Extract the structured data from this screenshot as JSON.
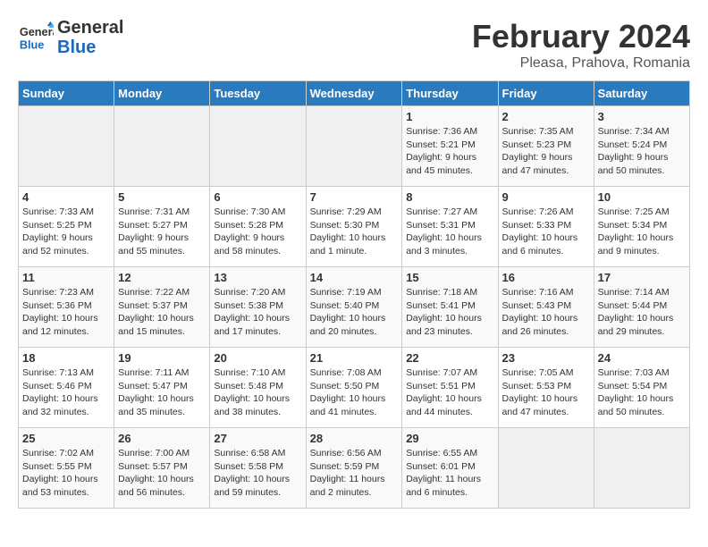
{
  "header": {
    "logo_line1": "General",
    "logo_line2": "Blue",
    "month": "February 2024",
    "location": "Pleasa, Prahova, Romania"
  },
  "weekdays": [
    "Sunday",
    "Monday",
    "Tuesday",
    "Wednesday",
    "Thursday",
    "Friday",
    "Saturday"
  ],
  "weeks": [
    [
      {
        "day": "",
        "info": ""
      },
      {
        "day": "",
        "info": ""
      },
      {
        "day": "",
        "info": ""
      },
      {
        "day": "",
        "info": ""
      },
      {
        "day": "1",
        "info": "Sunrise: 7:36 AM\nSunset: 5:21 PM\nDaylight: 9 hours\nand 45 minutes."
      },
      {
        "day": "2",
        "info": "Sunrise: 7:35 AM\nSunset: 5:23 PM\nDaylight: 9 hours\nand 47 minutes."
      },
      {
        "day": "3",
        "info": "Sunrise: 7:34 AM\nSunset: 5:24 PM\nDaylight: 9 hours\nand 50 minutes."
      }
    ],
    [
      {
        "day": "4",
        "info": "Sunrise: 7:33 AM\nSunset: 5:25 PM\nDaylight: 9 hours\nand 52 minutes."
      },
      {
        "day": "5",
        "info": "Sunrise: 7:31 AM\nSunset: 5:27 PM\nDaylight: 9 hours\nand 55 minutes."
      },
      {
        "day": "6",
        "info": "Sunrise: 7:30 AM\nSunset: 5:28 PM\nDaylight: 9 hours\nand 58 minutes."
      },
      {
        "day": "7",
        "info": "Sunrise: 7:29 AM\nSunset: 5:30 PM\nDaylight: 10 hours\nand 1 minute."
      },
      {
        "day": "8",
        "info": "Sunrise: 7:27 AM\nSunset: 5:31 PM\nDaylight: 10 hours\nand 3 minutes."
      },
      {
        "day": "9",
        "info": "Sunrise: 7:26 AM\nSunset: 5:33 PM\nDaylight: 10 hours\nand 6 minutes."
      },
      {
        "day": "10",
        "info": "Sunrise: 7:25 AM\nSunset: 5:34 PM\nDaylight: 10 hours\nand 9 minutes."
      }
    ],
    [
      {
        "day": "11",
        "info": "Sunrise: 7:23 AM\nSunset: 5:36 PM\nDaylight: 10 hours\nand 12 minutes."
      },
      {
        "day": "12",
        "info": "Sunrise: 7:22 AM\nSunset: 5:37 PM\nDaylight: 10 hours\nand 15 minutes."
      },
      {
        "day": "13",
        "info": "Sunrise: 7:20 AM\nSunset: 5:38 PM\nDaylight: 10 hours\nand 17 minutes."
      },
      {
        "day": "14",
        "info": "Sunrise: 7:19 AM\nSunset: 5:40 PM\nDaylight: 10 hours\nand 20 minutes."
      },
      {
        "day": "15",
        "info": "Sunrise: 7:18 AM\nSunset: 5:41 PM\nDaylight: 10 hours\nand 23 minutes."
      },
      {
        "day": "16",
        "info": "Sunrise: 7:16 AM\nSunset: 5:43 PM\nDaylight: 10 hours\nand 26 minutes."
      },
      {
        "day": "17",
        "info": "Sunrise: 7:14 AM\nSunset: 5:44 PM\nDaylight: 10 hours\nand 29 minutes."
      }
    ],
    [
      {
        "day": "18",
        "info": "Sunrise: 7:13 AM\nSunset: 5:46 PM\nDaylight: 10 hours\nand 32 minutes."
      },
      {
        "day": "19",
        "info": "Sunrise: 7:11 AM\nSunset: 5:47 PM\nDaylight: 10 hours\nand 35 minutes."
      },
      {
        "day": "20",
        "info": "Sunrise: 7:10 AM\nSunset: 5:48 PM\nDaylight: 10 hours\nand 38 minutes."
      },
      {
        "day": "21",
        "info": "Sunrise: 7:08 AM\nSunset: 5:50 PM\nDaylight: 10 hours\nand 41 minutes."
      },
      {
        "day": "22",
        "info": "Sunrise: 7:07 AM\nSunset: 5:51 PM\nDaylight: 10 hours\nand 44 minutes."
      },
      {
        "day": "23",
        "info": "Sunrise: 7:05 AM\nSunset: 5:53 PM\nDaylight: 10 hours\nand 47 minutes."
      },
      {
        "day": "24",
        "info": "Sunrise: 7:03 AM\nSunset: 5:54 PM\nDaylight: 10 hours\nand 50 minutes."
      }
    ],
    [
      {
        "day": "25",
        "info": "Sunrise: 7:02 AM\nSunset: 5:55 PM\nDaylight: 10 hours\nand 53 minutes."
      },
      {
        "day": "26",
        "info": "Sunrise: 7:00 AM\nSunset: 5:57 PM\nDaylight: 10 hours\nand 56 minutes."
      },
      {
        "day": "27",
        "info": "Sunrise: 6:58 AM\nSunset: 5:58 PM\nDaylight: 10 hours\nand 59 minutes."
      },
      {
        "day": "28",
        "info": "Sunrise: 6:56 AM\nSunset: 5:59 PM\nDaylight: 11 hours\nand 2 minutes."
      },
      {
        "day": "29",
        "info": "Sunrise: 6:55 AM\nSunset: 6:01 PM\nDaylight: 11 hours\nand 6 minutes."
      },
      {
        "day": "",
        "info": ""
      },
      {
        "day": "",
        "info": ""
      }
    ]
  ]
}
